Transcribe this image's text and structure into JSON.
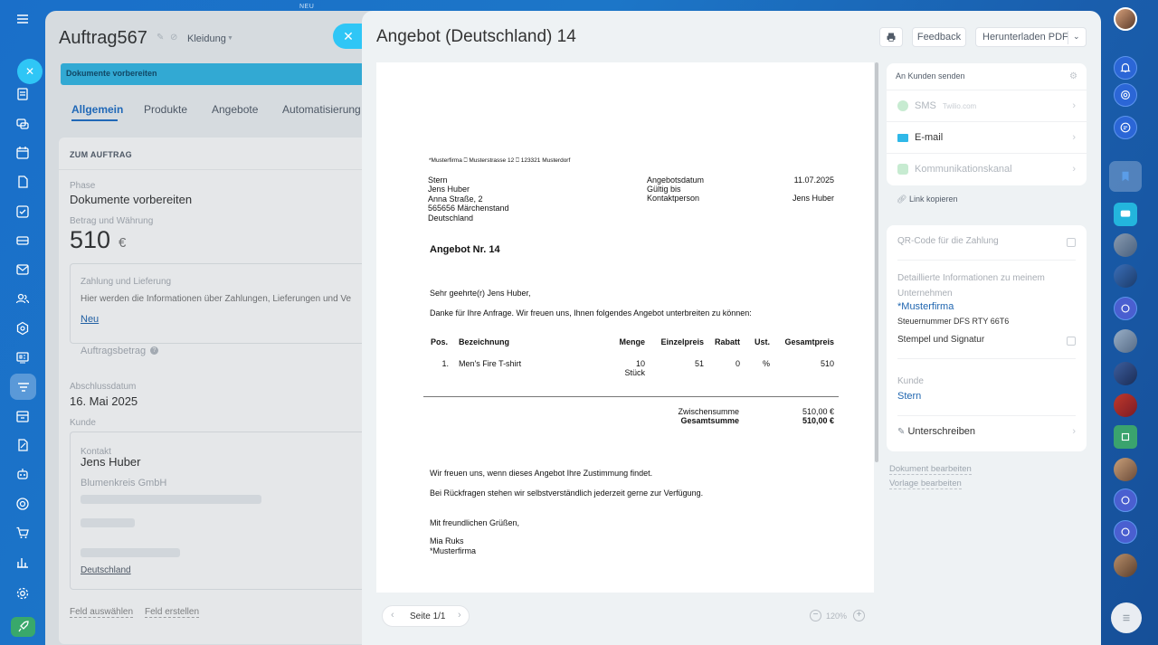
{
  "top_badge": "NEU",
  "deal": {
    "title": "Auftrag567",
    "category": "Kleidung",
    "stage_bar": "Dokumente vorbereiten",
    "tabs": [
      "Allgemein",
      "Produkte",
      "Angebote",
      "Automatisierung"
    ],
    "section_title": "ZUM AUFTRAG",
    "phase_label": "Phase",
    "phase_value": "Dokumente vorbereiten",
    "amount_label": "Betrag und Währung",
    "amount_value": "510",
    "amount_currency": "€",
    "payment_title": "Zahlung und Lieferung",
    "payment_text": "Hier werden die Informationen über Zahlungen, Lieferungen und Ve",
    "new_link": "Neu",
    "order_amount_label": "Auftragsbetrag",
    "close_date_label": "Abschlussdatum",
    "close_date_value": "16. Mai 2025",
    "client_label": "Kunde",
    "contact_label": "Kontakt",
    "contact_name": "Jens Huber",
    "company": "Blumenkreis GmbH",
    "country": "Deutschland",
    "select_field": "Feld auswählen",
    "create_field": "Feld erstellen"
  },
  "slider": {
    "title": "Angebot (Deutschland) 14",
    "feedback": "Feedback",
    "download": "Herunterladen PDF"
  },
  "doc": {
    "sender_line": "*Musterfirma ⎕ Musterstrasse 12 ⎕ 123321 Musterdorf",
    "recipient": [
      "Stern",
      "Jens Huber",
      "Anna Straße, 2",
      "565656 Märchenstand",
      "Deutschland"
    ],
    "meta_labels": [
      "Angebotsdatum",
      "Gültig bis",
      "Kontaktperson"
    ],
    "offer_date": "11.07.2025",
    "contact_person": "Jens Huber",
    "heading": "Angebot Nr. 14",
    "greeting": "Sehr geehrte(r) Jens Huber,",
    "intro": "Danke für Ihre Anfrage. Wir freuen uns, Ihnen folgendes Angebot unterbreiten zu können:",
    "table_headers": [
      "Pos.",
      "Bezeichnung",
      "Menge",
      "Einzelpreis",
      "Rabatt",
      "Ust.",
      "Gesamtpreis"
    ],
    "item": {
      "pos": "1.",
      "name": "Men's Fire T-shirt",
      "qty": "10",
      "unit": "Stück",
      "price": "51",
      "discount": "0",
      "vat": "%",
      "total": "510"
    },
    "subtotal_label": "Zwischensumme",
    "subtotal": "510,00 €",
    "total_label": "Gesamtsumme",
    "total": "510,00 €",
    "closing1": "Wir freuen uns, wenn dieses Angebot Ihre Zustimmung findet.",
    "closing2": "Bei Rückfragen stehen wir selbstverständlich jederzeit gerne zur Verfügung.",
    "regards": "Mit freundlichen Grüßen,",
    "sign_name": "Mia Ruks",
    "sign_company": "*Musterfirma"
  },
  "pager": {
    "label": "Seite 1/1",
    "zoom": "120%"
  },
  "send": {
    "title": "An Kunden senden",
    "sms": "SMS",
    "sms_provider": "Twilio.com",
    "email": "E-mail",
    "channel": "Kommunikationskanal",
    "copy_link": "Link kopieren"
  },
  "settings": {
    "qr_label": "QR-Code für die Zahlung",
    "details_label": "Detaillierte Informationen zu meinem Unternehmen",
    "company_link": "*Musterfirma",
    "tax_number": "Steuernummer DFS RTY 66T6",
    "stamp_label": "Stempel und Signatur",
    "client_label": "Kunde",
    "client_value": "Stern",
    "sign_label": "Unterschreiben"
  },
  "links": {
    "edit_doc": "Dokument bearbeiten",
    "edit_template": "Vorlage bearbeiten"
  },
  "colors": {
    "accent": "#2fc6f6",
    "link": "#2066b0",
    "bg": "#1c76c8"
  }
}
